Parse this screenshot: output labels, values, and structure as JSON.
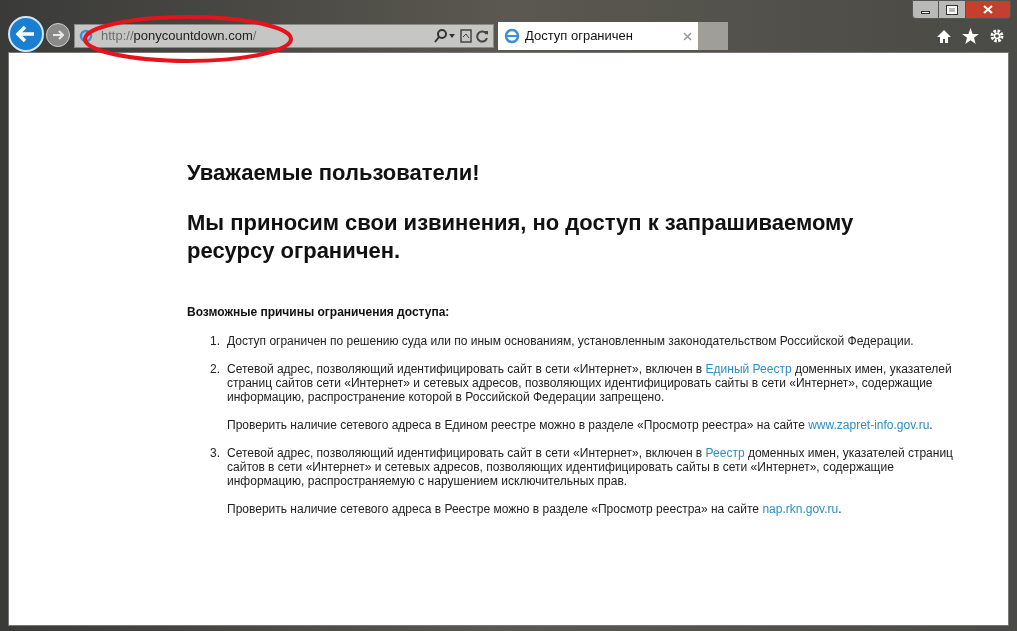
{
  "address_bar": {
    "url_prefix": "http://",
    "url_host": "ponycountdown.com",
    "url_suffix": "/"
  },
  "tabs": [
    {
      "title": "Доступ ограничен",
      "selected": true
    }
  ],
  "annotation": {
    "kind": "ellipse",
    "color": "#e3141c"
  },
  "page": {
    "greeting": "Уважаемые пользователи!",
    "apology": "Мы приносим свои извинения, но доступ к запрашиваемому ресурсу ограничен.",
    "reasons_title": "Возможные причины ограничения доступа:",
    "reasons": [
      {
        "number": "1.",
        "paragraphs": [
          {
            "before": "Доступ ограничен  по решению суда или по иным основаниям, установленным законодательством Российской Федерации."
          }
        ]
      },
      {
        "number": "2.",
        "paragraphs": [
          {
            "before": "Сетевой адрес, позволяющий идентифицировать сайт в сети «Интернет», включен в ",
            "link": "Единый Реестр",
            "after": " доменных имен, указателей страниц сайтов сети «Интернет» и сетевых адресов, позволяющих идентифицировать сайты в сети «Интернет», содержащие информацию, распространение которой в Российской Федерации запрещено."
          },
          {
            "before": "Проверить наличие сетевого адреса в Едином реестре можно в разделе «Просмотр реестра» на сайте ",
            "link": "www.zapret-info.gov.ru",
            "after": "."
          }
        ]
      },
      {
        "number": "3.",
        "paragraphs": [
          {
            "before": "Сетевой адрес, позволяющий идентифицировать сайт в сети «Интернет», включен в ",
            "link": "Реестр",
            "after": " доменных имен, указателей страниц сайтов в сети «Интернет» и сетевых адресов, позволяющих идентифицировать сайты в сети «Интернет», содержащие информацию, распространяемую с нарушением исключительных прав."
          },
          {
            "before": "Проверить наличие сетевого адреса в Реестре можно в разделе «Просмотр реестра» на сайте ",
            "link": "nap.rkn.gov.ru",
            "after": "."
          }
        ]
      }
    ]
  }
}
